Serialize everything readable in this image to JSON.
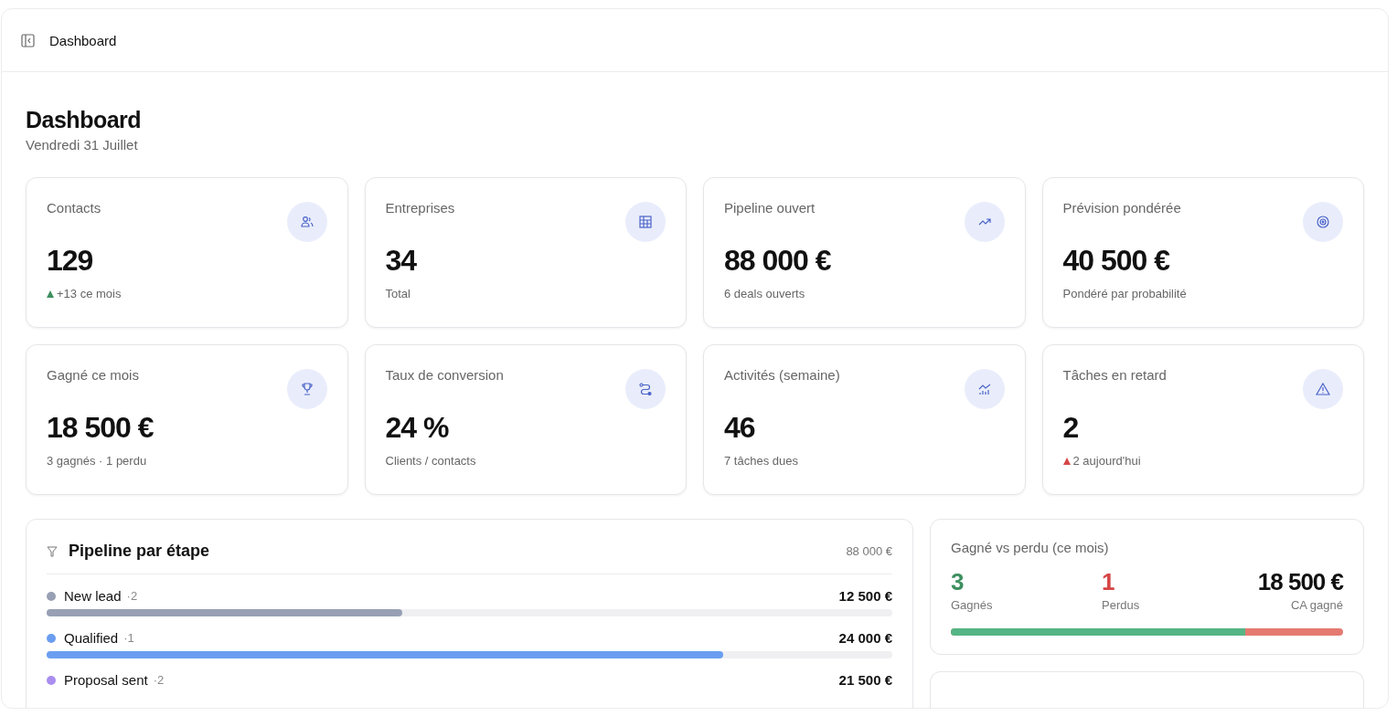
{
  "header": {
    "title": "Dashboard"
  },
  "page": {
    "title": "Dashboard",
    "subtitle": "Vendredi 31 Juillet"
  },
  "kpis": [
    {
      "label": "Contacts",
      "value": "129",
      "note": {
        "kind": "up",
        "text": "+13 ce mois"
      }
    },
    {
      "label": "Entreprises",
      "value": "34",
      "note": {
        "kind": "plain",
        "text": "Total"
      }
    },
    {
      "label": "Pipeline ouvert",
      "value": "88 000 €",
      "note": {
        "kind": "plain",
        "text": "6 deals ouverts"
      }
    },
    {
      "label": "Prévision pondérée",
      "value": "40 500 €",
      "note": {
        "kind": "plain",
        "text": "Pondéré par probabilité"
      }
    },
    {
      "label": "Gagné ce mois",
      "value": "18 500 €",
      "note": {
        "kind": "plain",
        "text": "3 gagnés · 1 perdu"
      }
    },
    {
      "label": "Taux de conversion",
      "value": "24 %",
      "note": {
        "kind": "plain",
        "text": "Clients / contacts"
      }
    },
    {
      "label": "Activités (semaine)",
      "value": "46",
      "note": {
        "kind": "plain",
        "text": "7 tâches dues"
      }
    },
    {
      "label": "Tâches en retard",
      "value": "2",
      "note": {
        "kind": "alert",
        "text": "2 aujourd'hui"
      }
    }
  ],
  "pipeline": {
    "title": "Pipeline par étape",
    "total": "88 000 €",
    "stages": [
      {
        "name": "New lead",
        "count": "·2",
        "amount": "12 500 €",
        "color": "#97a0b4",
        "level": 0.42
      },
      {
        "name": "Qualified",
        "count": "·1",
        "amount": "24 000 €",
        "color": "#6b9ef0",
        "level": 0.8
      },
      {
        "name": "Proposal sent",
        "count": "·2",
        "amount": "21 500 €",
        "color": "#a98ef0"
      }
    ]
  },
  "winloss": {
    "title": "Gagné vs perdu (ce mois)",
    "won": "3",
    "won_label": "Gagnés",
    "lost": "1",
    "lost_label": "Perdus",
    "revenue": "18 500 €",
    "revenue_label": "CA gagné",
    "level": 0.75
  }
}
